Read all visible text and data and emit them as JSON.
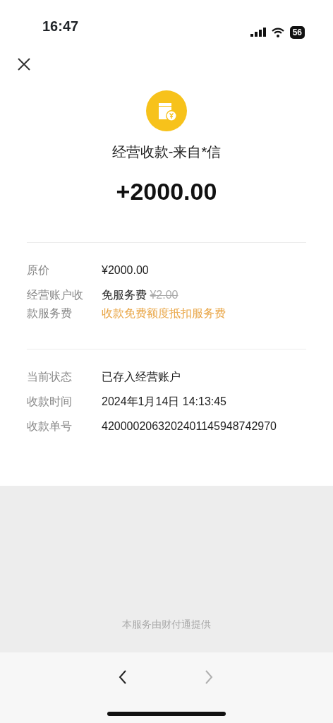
{
  "status_bar": {
    "time": "16:47",
    "battery": "56"
  },
  "payment": {
    "title": "经营收款-来自*信",
    "amount": "+2000.00"
  },
  "sections": [
    {
      "rows": [
        {
          "label": "原价",
          "value": "¥2000.00"
        },
        {
          "label": "经营账户收款服务费",
          "value": "免服务费",
          "struck": "¥2.00",
          "note": "收款免费额度抵扣服务费"
        }
      ]
    },
    {
      "rows": [
        {
          "label": "当前状态",
          "value": "已存入经营账户"
        },
        {
          "label": "收款时间",
          "value": "2024年1月14日 14:13:45"
        },
        {
          "label": "收款单号",
          "value": "4200002063202401145948742970"
        }
      ]
    }
  ],
  "footer": {
    "provider": "本服务由财付通提供"
  },
  "nav": {
    "back_disabled": false,
    "forward_disabled": true
  }
}
